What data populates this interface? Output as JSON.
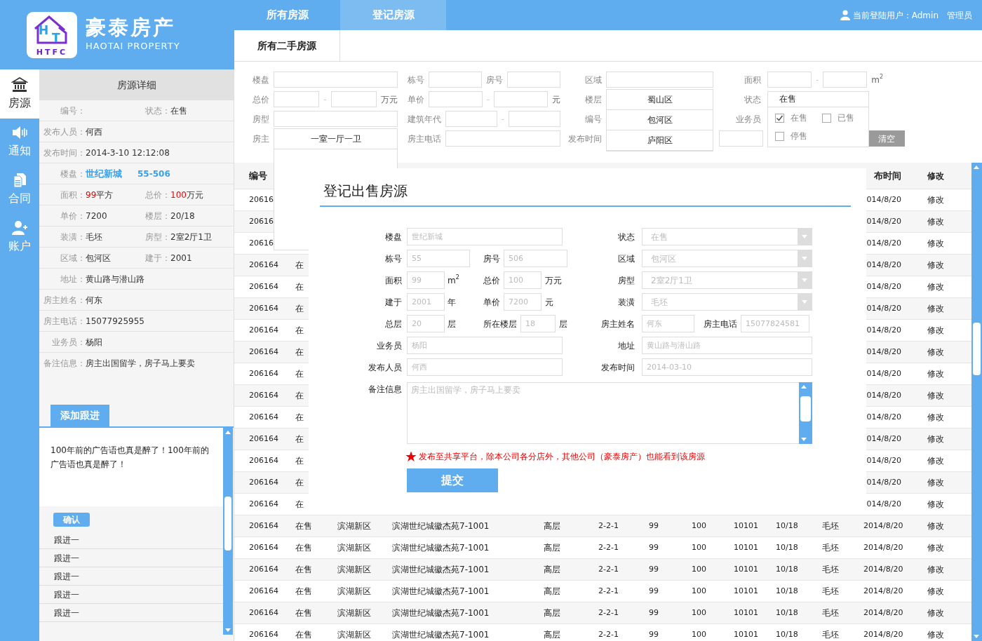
{
  "logo": {
    "letters": [
      "H",
      "T"
    ],
    "caption": "HTFC"
  },
  "brand": {
    "name": "豪泰房产",
    "tagline": "HAOTAI PROPERTY"
  },
  "sidebar": [
    {
      "label": "房源",
      "kind": "bank",
      "selected": true
    },
    {
      "label": "通知",
      "kind": "speaker",
      "selected": false
    },
    {
      "label": "合同",
      "kind": "document",
      "selected": false
    },
    {
      "label": "账户",
      "kind": "user-add",
      "selected": false
    }
  ],
  "top_nav": [
    {
      "label": "所有房源",
      "selected": false
    },
    {
      "label": "登记房源",
      "selected": true
    }
  ],
  "user": {
    "text": "当前登陆用户：Admin",
    "role": "管理员"
  },
  "sub_tabs": [
    {
      "label": "所有二手房源",
      "selected": true
    }
  ],
  "detail": {
    "title": "房源详细",
    "rows": [
      [
        {
          "label": "编号："
        },
        {
          "label": "状态：",
          "value": "在售"
        }
      ],
      [
        {
          "label": "发布人员：",
          "value": "何西"
        }
      ],
      [
        {
          "label": "发布时间：",
          "value": "2014-3-10 12:12:08"
        }
      ],
      [
        {
          "label": "楼盘：",
          "value": "世纪新城",
          "extra": "55-506",
          "kind": "link"
        }
      ],
      [
        {
          "label": "面积：",
          "number": "99",
          "value": "平方"
        },
        {
          "label": "总价：",
          "number": "100",
          "value": "万元"
        }
      ],
      [
        {
          "label": "单价：",
          "value": "7200"
        },
        {
          "label": "楼层：",
          "value": "20/18"
        }
      ],
      [
        {
          "label": "装潢：",
          "value": "毛坯"
        },
        {
          "label": "房型：",
          "value": "2室2厅1卫"
        }
      ],
      [
        {
          "label": "区域：",
          "value": "包河区"
        },
        {
          "label": "建于：",
          "value": "2001"
        }
      ],
      [
        {
          "label": "地址：",
          "value": "黄山路与潜山路"
        }
      ],
      [
        {
          "label": "房主姓名：",
          "value": "何东"
        }
      ],
      [
        {
          "label": "房主电话：",
          "value": "15077925955"
        }
      ],
      [
        {
          "label": "业务员：",
          "value": "杨阳"
        }
      ],
      [
        {
          "label": "备注信息：",
          "value": "房主出国留学，房子马上要卖"
        }
      ]
    ]
  },
  "follow_up": {
    "add_button": "添加跟进",
    "text": "100年前的广告语也真是醉了！100年前的广告语也真是醉了！",
    "confirm": "确认",
    "items": [
      "跟进一",
      "跟进一",
      "跟进一",
      "跟进一",
      "跟进一"
    ]
  },
  "filters": [
    [
      [
        {
          "kind": "label",
          "text": "楼盘"
        },
        {
          "kind": "input"
        }
      ],
      [
        {
          "kind": "label",
          "text": "栋号"
        },
        {
          "kind": "input"
        },
        {
          "kind": "label",
          "text": "房号"
        },
        {
          "kind": "input"
        }
      ],
      [
        {
          "kind": "label",
          "text": "区域"
        },
        {
          "kind": "input",
          "options": [
            "蜀山区",
            "包河区",
            "庐阳区"
          ]
        }
      ],
      [
        {
          "kind": "label",
          "text": "面积"
        },
        {
          "kind": "input"
        },
        {
          "kind": "dash",
          "text": "-"
        },
        {
          "kind": "input"
        },
        {
          "kind": "unit",
          "text": "m$^{2}$"
        }
      ]
    ],
    [
      [
        {
          "kind": "label",
          "text": "总价"
        },
        {
          "kind": "input"
        },
        {
          "kind": "dash",
          "text": "-"
        },
        {
          "kind": "input"
        },
        {
          "kind": "unit",
          "text": "万元"
        }
      ],
      [
        {
          "kind": "label",
          "text": "单价"
        },
        {
          "kind": "input"
        },
        {
          "kind": "dash",
          "text": "-"
        },
        {
          "kind": "input"
        },
        {
          "kind": "unit",
          "text": "元"
        }
      ],
      [
        {
          "kind": "label",
          "text": "楼层"
        }
      ],
      [
        {
          "kind": "label",
          "text": "状态"
        },
        {
          "kind": "select",
          "value": "在售",
          "choices": [
            {
              "label": "在售",
              "checked": true
            },
            {
              "label": "已售",
              "checked": false
            },
            {
              "label": "停售",
              "checked": false
            }
          ]
        }
      ]
    ],
    [
      [
        {
          "kind": "label",
          "text": "房型"
        },
        {
          "kind": "input",
          "options": [
            "一室一厅一卫"
          ]
        }
      ],
      [
        {
          "kind": "label",
          "text": "建筑年代"
        },
        {
          "kind": "input"
        },
        {
          "kind": "dash",
          "text": "-"
        },
        {
          "kind": "input"
        }
      ],
      [
        {
          "kind": "label",
          "text": "编号"
        }
      ],
      [
        {
          "kind": "label",
          "text": "业务员"
        }
      ]
    ],
    [
      [
        {
          "kind": "label",
          "text": "房主"
        }
      ],
      [
        {
          "kind": "label",
          "text": "房主电话"
        },
        {
          "kind": "input"
        }
      ],
      [
        {
          "kind": "label",
          "text": "发布时间"
        }
      ],
      [
        {
          "kind": "input"
        },
        {
          "kind": "button",
          "text": "清空"
        }
      ]
    ]
  ],
  "table": {
    "header": {
      "id": "编号",
      "published": "布时间",
      "edit": "修改"
    },
    "rows": [
      {
        "id": "20616",
        "published": "014/8/20",
        "edit": "修改"
      },
      {
        "id": "20616",
        "published": "014/8/20",
        "edit": "修改"
      },
      {
        "id": "20616",
        "published": "014/8/20",
        "edit": "修改"
      },
      {
        "id": "206164",
        "status": "在",
        "published": "014/8/20",
        "edit": "修改"
      },
      {
        "id": "206164",
        "status": "在",
        "published": "014/8/20",
        "edit": "修改"
      },
      {
        "id": "206164",
        "status": "在",
        "published": "014/8/20",
        "edit": "修改"
      },
      {
        "id": "206164",
        "status": "在",
        "published": "014/8/20",
        "edit": "修改"
      },
      {
        "id": "206164",
        "status": "在",
        "published": "014/8/20",
        "edit": "修改"
      },
      {
        "id": "206164",
        "status": "在",
        "published": "014/8/20",
        "edit": "修改"
      },
      {
        "id": "206164",
        "status": "在",
        "published": "014/8/20",
        "edit": "修改"
      },
      {
        "id": "206164",
        "status": "在",
        "published": "014/8/20",
        "edit": "修改"
      },
      {
        "id": "206164",
        "status": "在",
        "published": "014/8/20",
        "edit": "修改"
      },
      {
        "id": "206164",
        "status": "在",
        "published": "014/8/20",
        "edit": "修改"
      },
      {
        "id": "206164",
        "status": "在",
        "published": "014/8/20",
        "edit": "修改"
      },
      {
        "id": "206164",
        "status": "在",
        "published": "014/8/20",
        "edit": "修改"
      },
      {
        "id": "206164",
        "status": "在售",
        "district": "滨湖新区",
        "address": "滨湖世纪城徽杰苑7-1001",
        "floor_type": "高层",
        "unit_code": "2-2-1",
        "area": "99",
        "total_price": "100",
        "column_9": "10101",
        "floor": "10/18",
        "decoration": "毛坯",
        "published": "2014/8/20",
        "edit": "修改"
      },
      {
        "id": "206164",
        "status": "在售",
        "district": "滨湖新区",
        "address": "滨湖世纪城徽杰苑7-1001",
        "floor_type": "高层",
        "unit_code": "2-2-1",
        "area": "99",
        "total_price": "100",
        "column_9": "10101",
        "floor": "10/18",
        "decoration": "毛坯",
        "published": "2014/8/20",
        "edit": "修改"
      },
      {
        "id": "206164",
        "status": "在售",
        "district": "滨湖新区",
        "address": "滨湖世纪城徽杰苑7-1001",
        "floor_type": "高层",
        "unit_code": "2-2-1",
        "area": "99",
        "total_price": "100",
        "column_9": "10101",
        "floor": "10/18",
        "decoration": "毛坯",
        "published": "2014/8/20",
        "edit": "修改"
      },
      {
        "id": "206164",
        "status": "在售",
        "district": "滨湖新区",
        "address": "滨湖世纪城徽杰苑7-1001",
        "floor_type": "高层",
        "unit_code": "2-2-1",
        "area": "99",
        "total_price": "100",
        "column_9": "10101",
        "floor": "10/18",
        "decoration": "毛坯",
        "published": "2014/8/20",
        "edit": "修改"
      },
      {
        "id": "206164",
        "status": "在售",
        "district": "滨湖新区",
        "address": "滨湖世纪城徽杰苑7-1001",
        "floor_type": "高层",
        "unit_code": "2-2-1",
        "area": "99",
        "total_price": "100",
        "column_9": "10101",
        "floor": "10/18",
        "decoration": "毛坯",
        "published": "2014/8/20",
        "edit": "修改"
      },
      {
        "id": "206164",
        "status": "在售",
        "district": "滨湖新区",
        "address": "滨湖世纪城徽杰苑7-1001",
        "floor_type": "高层",
        "unit_code": "2-2-1",
        "area": "99",
        "total_price": "100",
        "column_9": "10101",
        "floor": "10/18",
        "decoration": "毛坯",
        "published": "2014/8/20",
        "edit": "修改"
      }
    ]
  },
  "modal": {
    "title": "登记出售房源",
    "left_rows": [
      [
        {
          "label": "楼盘",
          "placeholder": "世纪新城"
        }
      ],
      [
        {
          "label": "栋号",
          "placeholder": "55"
        },
        {
          "label": "房号",
          "placeholder": "506"
        }
      ],
      [
        {
          "label": "面积",
          "placeholder": "99",
          "unit": "m$^{2}$"
        },
        {
          "label": "总价",
          "placeholder": "100",
          "unit": "万元"
        }
      ],
      [
        {
          "label": "建于",
          "placeholder": "2001",
          "unit": "年"
        },
        {
          "label": "单价",
          "placeholder": "7200",
          "unit": "元"
        }
      ],
      [
        {
          "label": "总层",
          "placeholder": "20",
          "unit": "层"
        },
        {
          "label": "所在楼层",
          "placeholder": "18",
          "unit": "层"
        }
      ],
      [
        {
          "label": "业务员",
          "placeholder": "杨阳"
        }
      ],
      [
        {
          "label": "发布人员",
          "placeholder": "何西"
        }
      ]
    ],
    "right_rows": [
      [
        {
          "label": "状态",
          "kind": "select",
          "placeholder": "在售"
        }
      ],
      [
        {
          "label": "区域",
          "kind": "select",
          "placeholder": "包河区"
        }
      ],
      [
        {
          "label": "房型",
          "kind": "select",
          "placeholder": "2室2厅1卫"
        }
      ],
      [
        {
          "label": "装潢",
          "kind": "select",
          "placeholder": "毛坯"
        }
      ],
      [
        {
          "label": "房主姓名",
          "kind": "text",
          "placeholder": "何东"
        },
        {
          "label": "房主电话",
          "kind": "text",
          "placeholder": "15077824581"
        }
      ],
      [
        {
          "label": "地址",
          "kind": "text",
          "placeholder": "黄山路与潜山路"
        }
      ],
      [
        {
          "label": "发布时间",
          "kind": "text",
          "placeholder": "2014-03-10"
        }
      ]
    ],
    "remarks": {
      "label": "备注信息",
      "placeholder": "房主出国留学，房子马上要卖"
    },
    "notice": "发布至共享平台，除本公司各分店外，其他公司（豪泰房产）也能看到该房源",
    "submit": "提交"
  }
}
